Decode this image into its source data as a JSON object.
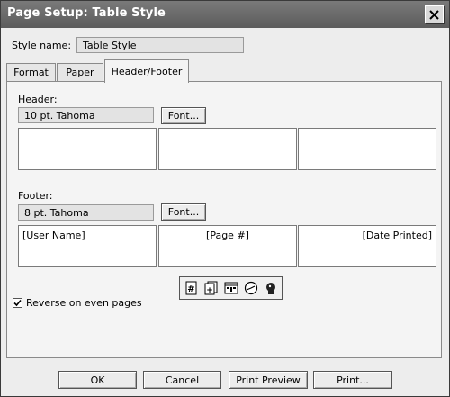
{
  "window": {
    "title": "Page Setup: Table Style"
  },
  "style_name": {
    "label": "Style name:",
    "label_underline_char": "n",
    "value": "Table Style"
  },
  "tabs": [
    {
      "label": "Format",
      "active": false
    },
    {
      "label": "Paper",
      "active": false
    },
    {
      "label": "Header/Footer",
      "active": true
    }
  ],
  "header": {
    "label": "Header:",
    "font_display": "10 pt. Tahoma",
    "font_button": "Font...",
    "sections": [
      "",
      "",
      ""
    ]
  },
  "footer": {
    "label": "Footer:",
    "font_display": "8 pt. Tahoma",
    "font_button": "Font...",
    "sections": [
      "[User Name]",
      "[Page #]",
      "[Date Printed]"
    ]
  },
  "insert_icons": [
    "page-number-icon",
    "total-pages-icon",
    "date-icon",
    "time-icon",
    "user-name-icon"
  ],
  "reverse_checkbox": {
    "label": "Reverse on even pages",
    "checked": true
  },
  "buttons": {
    "ok": "OK",
    "cancel": "Cancel",
    "print_preview": "Print Preview",
    "print": "Print..."
  }
}
